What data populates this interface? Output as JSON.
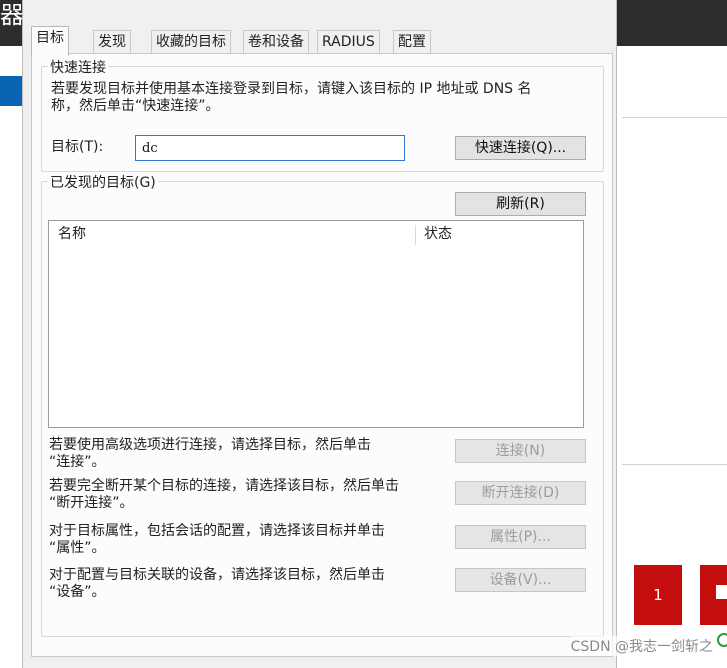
{
  "background": {
    "title_fragment": "器",
    "tile_number": "1",
    "watermark": "CSDN @我志一剑斩之"
  },
  "tabs": [
    {
      "label": "目标",
      "active": true
    },
    {
      "label": "发现",
      "active": false
    },
    {
      "label": "收藏的目标",
      "active": false
    },
    {
      "label": "卷和设备",
      "active": false
    },
    {
      "label": "RADIUS",
      "active": false
    },
    {
      "label": "配置",
      "active": false
    }
  ],
  "quick_connect": {
    "group_title": "快速连接",
    "description_line1": "若要发现目标并使用基本连接登录到目标，请键入该目标的 IP 地址或 DNS 名",
    "description_line2": "称，然后单击“快速连接”。",
    "target_label": "目标(T):",
    "target_value": "dc",
    "button_label": "快速连接(Q)..."
  },
  "discovered": {
    "group_title": "已发现的目标(G)",
    "refresh_label": "刷新(R)",
    "columns": [
      "名称",
      "状态"
    ],
    "rows": []
  },
  "actions": [
    {
      "line1": "若要使用高级选项进行连接，请选择目标，然后单击",
      "line2": "“连接”。",
      "button": "连接(N)",
      "enabled": false
    },
    {
      "line1": "若要完全断开某个目标的连接，请选择该目标，然后单击",
      "line2": "“断开连接”。",
      "button": "断开连接(D)",
      "enabled": false
    },
    {
      "line1": "对于目标属性，包括会话的配置，请选择该目标并单击",
      "line2": "“属性”。",
      "button": "属性(P)...",
      "enabled": false
    },
    {
      "line1": "对于配置与目标关联的设备，请选择该目标，然后单击",
      "line2": "“设备”。",
      "button": "设备(V)...",
      "enabled": false
    }
  ],
  "colors": {
    "input_focus_border": "#2f78d7",
    "tile_red": "#c40d0d",
    "dialog_bg": "#f0f0f0"
  }
}
